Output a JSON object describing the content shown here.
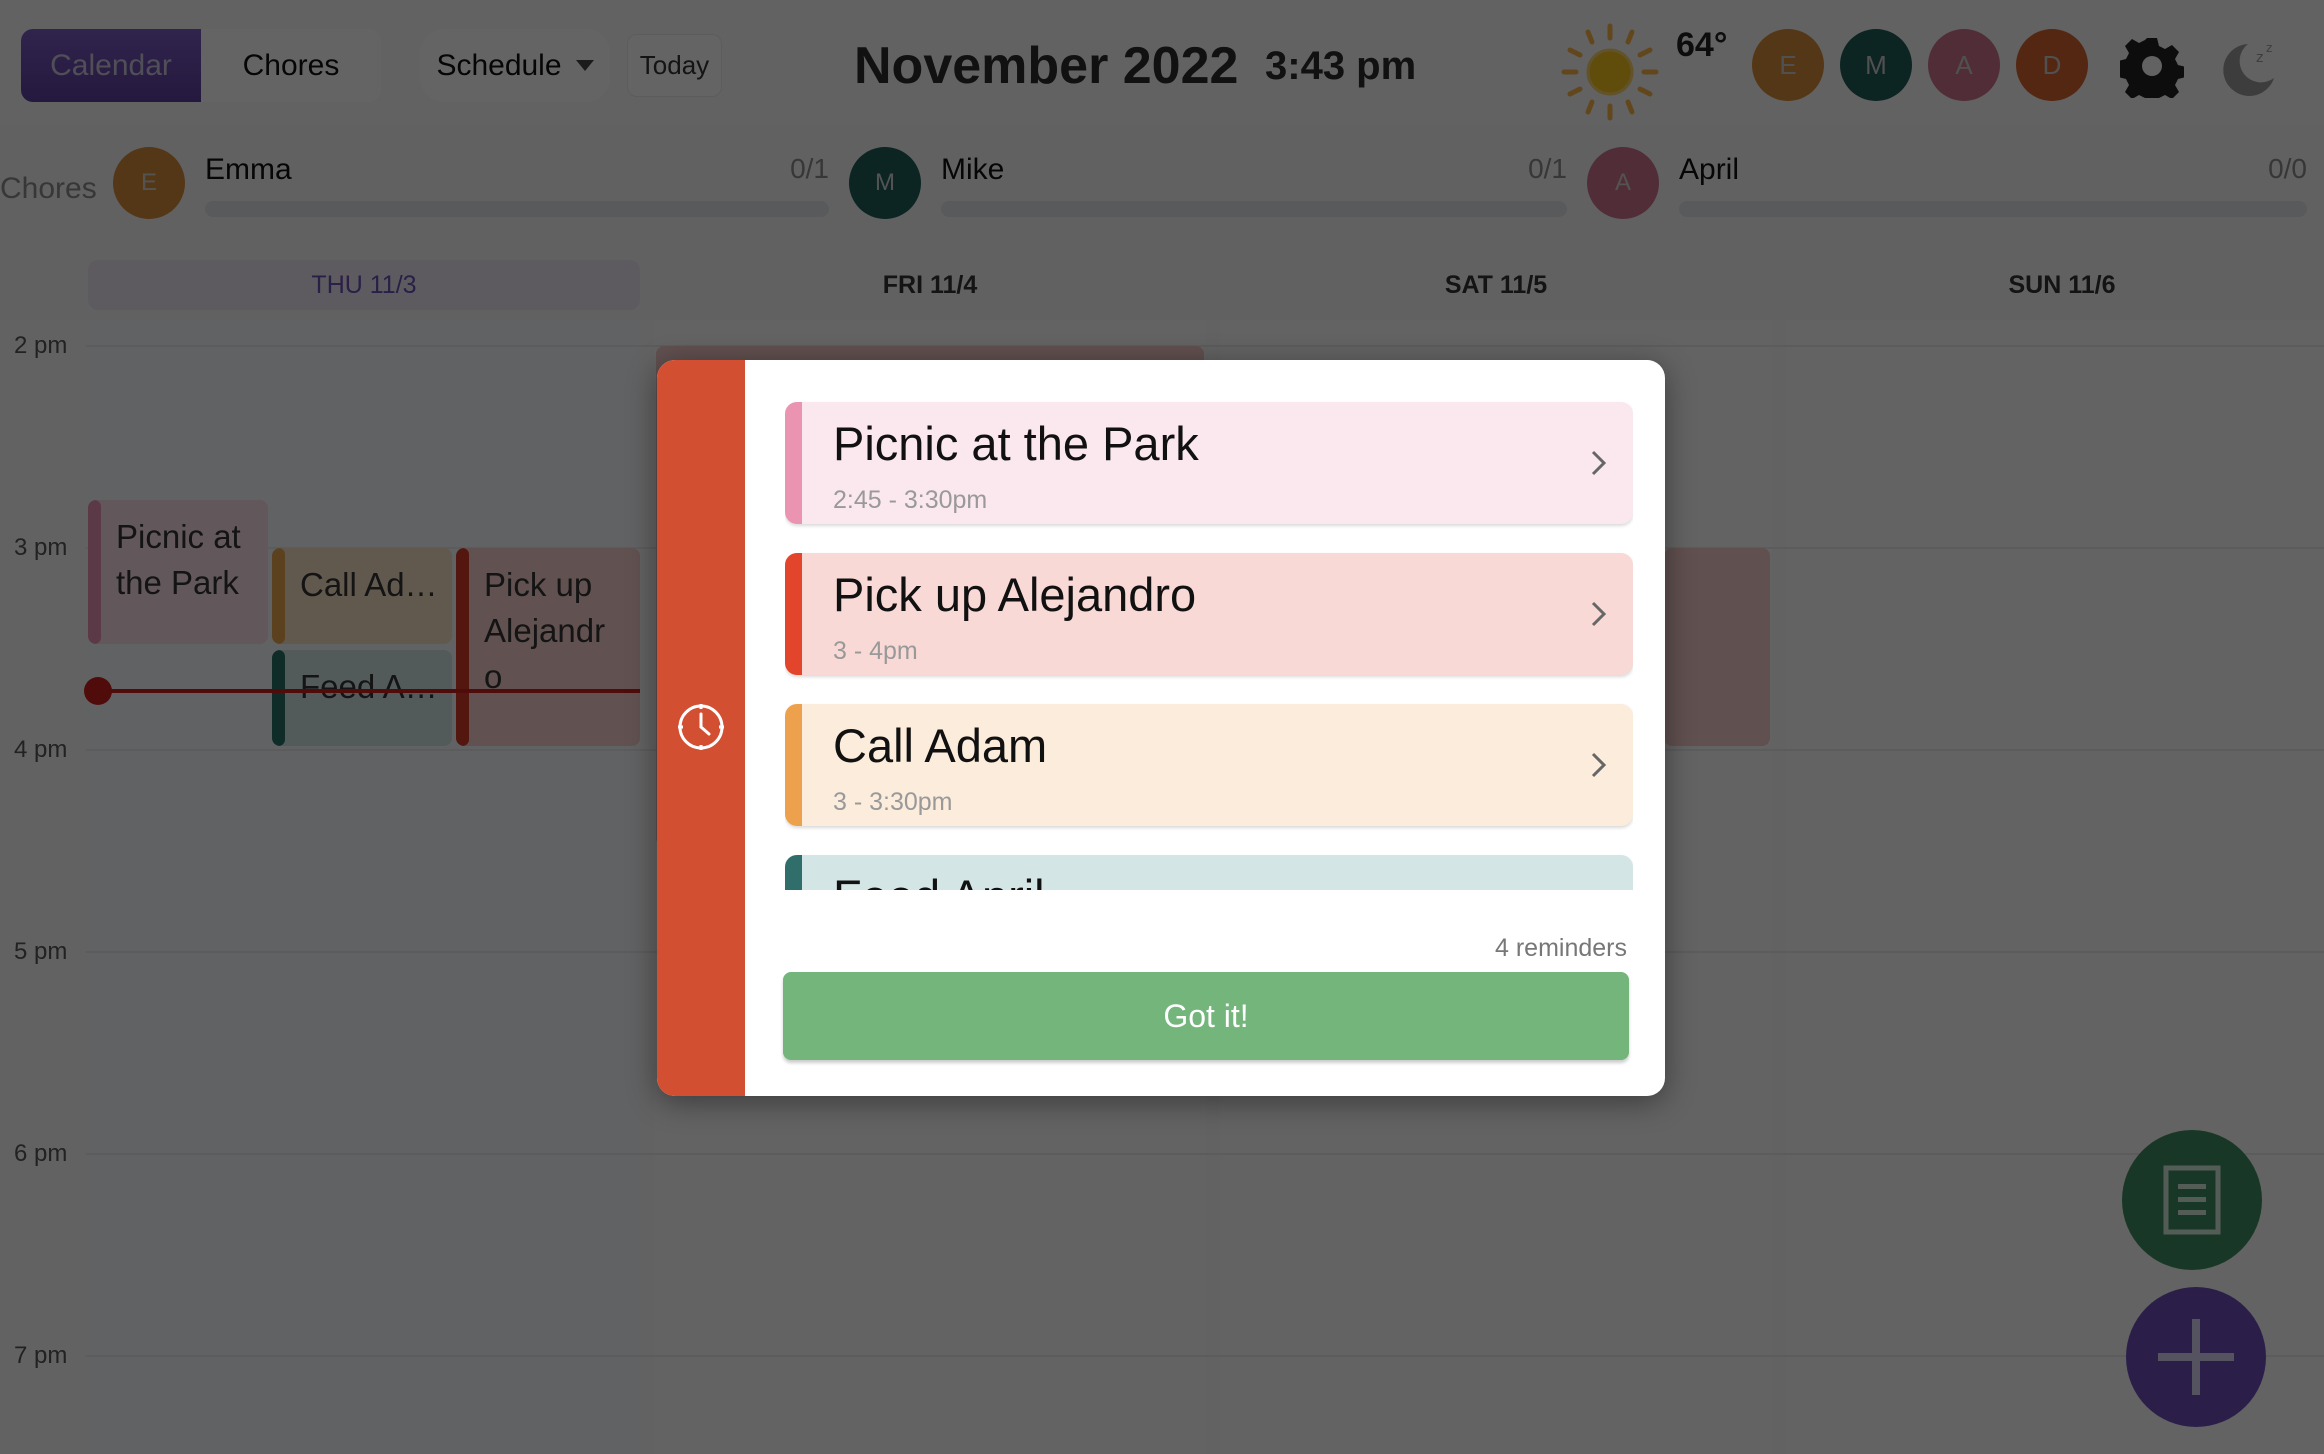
{
  "header": {
    "tabs": [
      {
        "label": "Calendar",
        "active": true
      },
      {
        "label": "Chores",
        "active": false
      }
    ],
    "view_select": {
      "selected": "Schedule"
    },
    "today_label": "Today",
    "month_title": "November 2022",
    "clock": "3:43 pm",
    "weather": {
      "icon": "sun-icon",
      "temperature": "64°"
    },
    "avatars": [
      {
        "initial": "E",
        "color": "#d28a37"
      },
      {
        "initial": "M",
        "color": "#1e5b56"
      },
      {
        "initial": "A",
        "color": "#c7728a"
      },
      {
        "initial": "D",
        "color": "#d2622d"
      }
    ],
    "settings_icon": "gear-icon",
    "sleep_icon": "moon-zzz-icon"
  },
  "chores": {
    "label": "Chores",
    "people": [
      {
        "initial": "E",
        "name": "Emma",
        "count": "0/1",
        "progress": 0,
        "color": "#d28a37"
      },
      {
        "initial": "M",
        "name": "Mike",
        "count": "0/1",
        "progress": 0,
        "color": "#1e5b56"
      },
      {
        "initial": "A",
        "name": "April",
        "count": "0/0",
        "progress": 0,
        "color": "#c7728a"
      }
    ]
  },
  "calendar": {
    "days": [
      {
        "label": "THU 11/3",
        "today": true
      },
      {
        "label": "FRI 11/4",
        "today": false
      },
      {
        "label": "SAT 11/5",
        "today": false
      },
      {
        "label": "SUN 11/6",
        "today": false
      }
    ],
    "hours": [
      "2 pm",
      "3 pm",
      "4 pm",
      "5 pm",
      "6 pm",
      "7 pm"
    ],
    "events": [
      {
        "title": "Picnic at\nthe Park",
        "day": 0,
        "bg": "#f6dbe4",
        "bar": "#e58fae"
      },
      {
        "title": "Call Ad…",
        "day": 0,
        "bg": "#f3dfc3",
        "bar": "#e4a24c"
      },
      {
        "title": "Feed A…",
        "day": 0,
        "bg": "#cfe2e0",
        "bar": "#2a6e67"
      },
      {
        "title": "Pick up\nAlejandr\no",
        "day": 0,
        "bg": "#f3cdca",
        "bar": "#cf3b28"
      }
    ],
    "now_time": "3:43 pm"
  },
  "fabs": {
    "notes_icon": "notes-list-icon",
    "add_icon": "plus-icon"
  },
  "reminders_modal": {
    "side_icon": "clock-icon",
    "items": [
      {
        "title": "Picnic at the Park",
        "time": "2:45 - 3:30pm",
        "bg": "#fae8ee",
        "bar": "#ea94b2"
      },
      {
        "title": "Pick up Alejandro",
        "time": "3 - 4pm",
        "bg": "#f8d9d6",
        "bar": "#e2452b"
      },
      {
        "title": "Call Adam",
        "time": "3 - 3:30pm",
        "bg": "#fbecdc",
        "bar": "#eea14d"
      },
      {
        "title": "Feed April",
        "time": "",
        "bg": "#d4e5e5",
        "bar": "#2f6e6a"
      }
    ],
    "count_label": "4 reminders",
    "confirm_label": "Got it!",
    "colors": {
      "side": "#d34f31",
      "confirm": "#73b57a"
    }
  }
}
